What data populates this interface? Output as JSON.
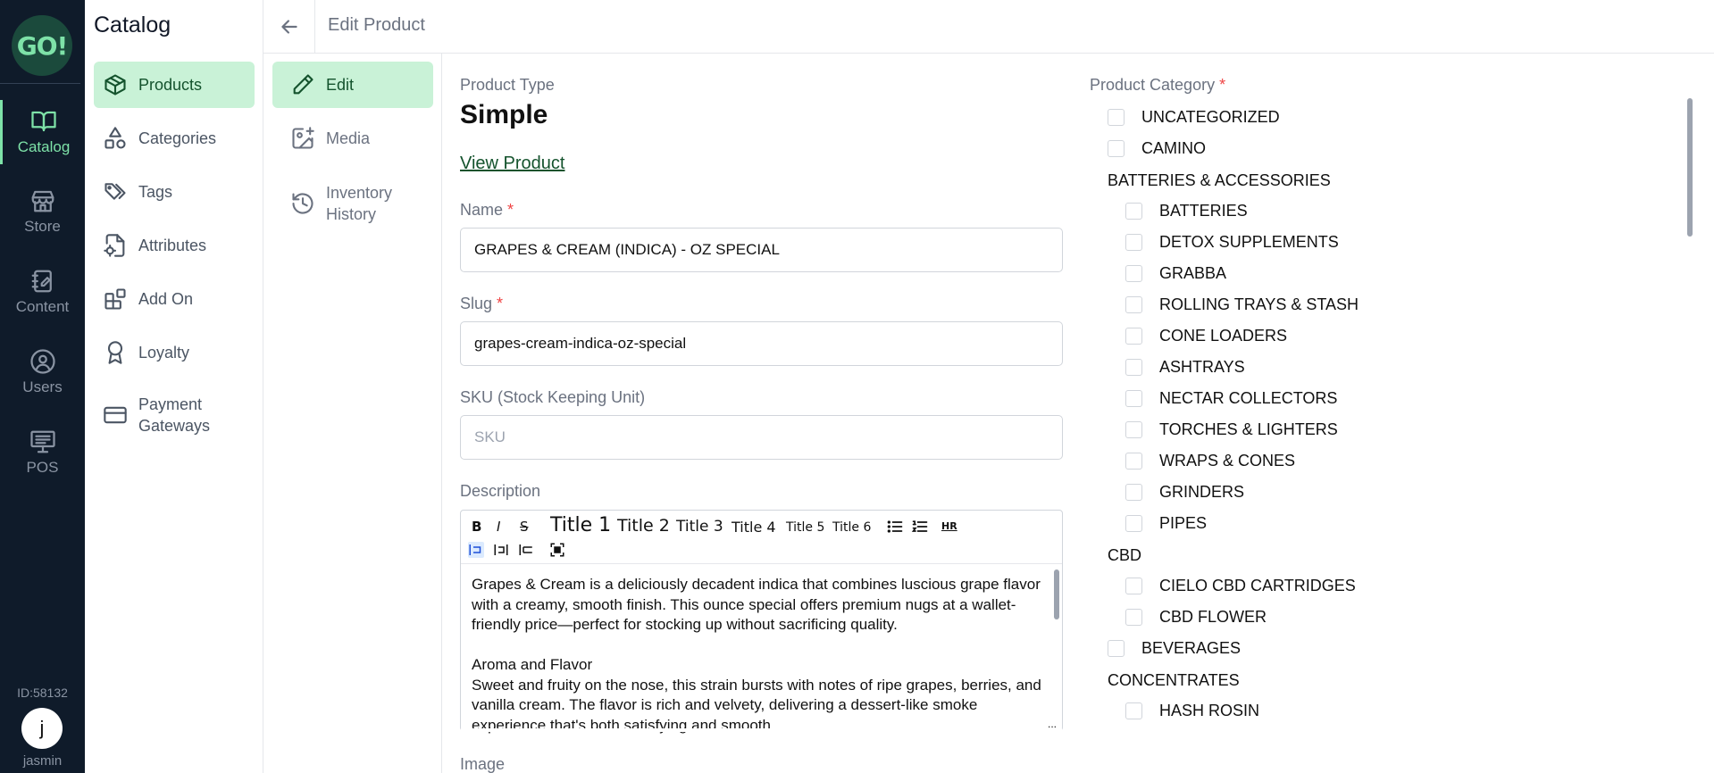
{
  "rail": {
    "logo": "GO!",
    "items": [
      {
        "label": "Catalog",
        "icon": "book-open-icon",
        "active": true
      },
      {
        "label": "Store",
        "icon": "store-icon",
        "active": false
      },
      {
        "label": "Content",
        "icon": "notebook-icon",
        "active": false
      },
      {
        "label": "Users",
        "icon": "user-circle-icon",
        "active": false
      },
      {
        "label": "POS",
        "icon": "monitor-icon",
        "active": false
      }
    ],
    "account_id": "ID:58132",
    "avatar_initial": "j",
    "username": "jasmin"
  },
  "sidebar": {
    "title": "Catalog",
    "items": [
      {
        "label": "Products",
        "icon": "box-icon",
        "active": true
      },
      {
        "label": "Categories",
        "icon": "shapes-icon",
        "active": false
      },
      {
        "label": "Tags",
        "icon": "tags-icon",
        "active": false
      },
      {
        "label": "Attributes",
        "icon": "file-settings-icon",
        "active": false
      },
      {
        "label": "Add On",
        "icon": "blocks-icon",
        "active": false
      },
      {
        "label": "Loyalty",
        "icon": "award-icon",
        "active": false
      },
      {
        "label": "Payment Gateways",
        "icon": "credit-card-icon",
        "active": false
      }
    ]
  },
  "header": {
    "title": "Edit Product",
    "back_icon": "arrow-left-icon"
  },
  "tabs": [
    {
      "label": "Edit",
      "icon": "pencil-icon",
      "active": true
    },
    {
      "label": "Media",
      "icon": "image-plus-icon",
      "active": false
    },
    {
      "label": "Inventory History",
      "icon": "history-icon",
      "active": false
    }
  ],
  "form": {
    "product_type_label": "Product Type",
    "product_type": "Simple",
    "view_product_link": "View Product",
    "name_label": "Name",
    "name_value": "GRAPES & CREAM (INDICA) - OZ SPECIAL",
    "slug_label": "Slug",
    "slug_value": "grapes-cream-indica-oz-special",
    "sku_label": "SKU (Stock Keeping Unit)",
    "sku_placeholder": "SKU",
    "description_label": "Description",
    "required_mark": "*",
    "image_label": "Image",
    "toolbar": {
      "bold": "B",
      "italic": "I",
      "strike": "S",
      "title1": "Title 1",
      "title2": "Title 2",
      "title3": "Title 3",
      "title4": "Title 4",
      "title5": "Title 5",
      "title6": "Title 6",
      "hr": "HR"
    },
    "description_paragraphs": [
      "Grapes & Cream is a deliciously decadent indica that combines luscious grape flavor with a creamy, smooth finish. This ounce special offers premium nugs at a wallet-friendly price—perfect for stocking up without sacrificing quality.",
      "Aroma and Flavor",
      "Sweet and fruity on the nose, this strain bursts with notes of ripe grapes, berries, and vanilla cream. The flavor is rich and velvety, delivering a dessert-like smoke experience that's both satisfying and smooth."
    ]
  },
  "categories": {
    "label": "Product Category",
    "required_mark": "*",
    "top": [
      "UNCATEGORIZED",
      "CAMINO"
    ],
    "group1": "BATTERIES & ACCESSORIES",
    "group1_items": [
      "BATTERIES",
      "DETOX SUPPLEMENTS",
      "GRABBA",
      "ROLLING TRAYS & STASH",
      "CONE LOADERS",
      "ASHTRAYS",
      "NECTAR COLLECTORS",
      "TORCHES & LIGHTERS",
      "WRAPS & CONES",
      "GRINDERS",
      "PIPES"
    ],
    "group2": "CBD",
    "group2_items": [
      "CIELO CBD CARTRIDGES",
      "CBD FLOWER"
    ],
    "beverages": "BEVERAGES",
    "group3": "CONCENTRATES",
    "group3_items": [
      "HASH ROSIN"
    ]
  }
}
